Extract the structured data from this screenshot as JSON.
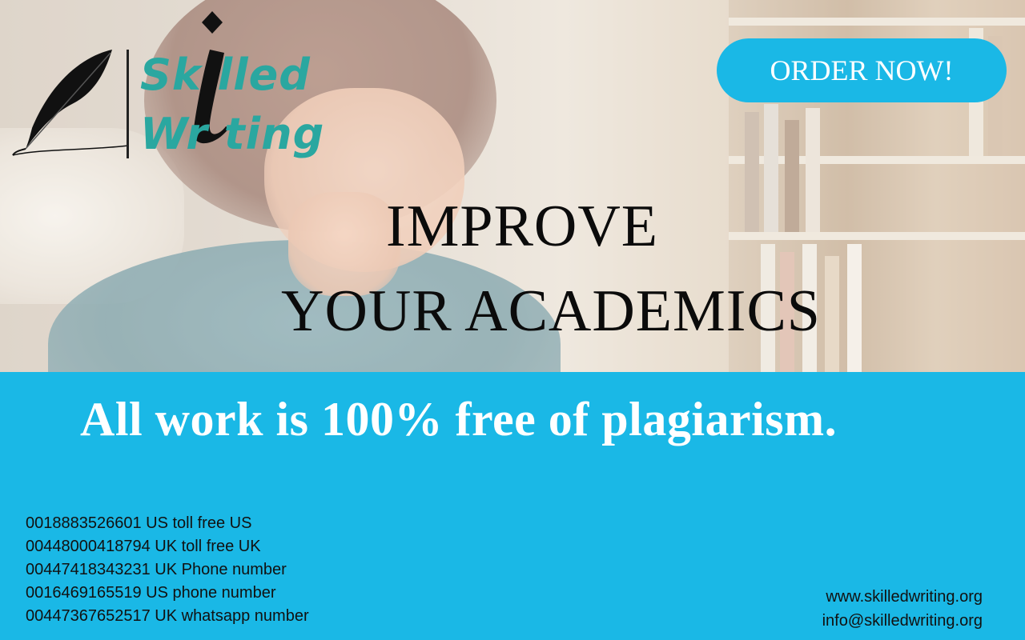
{
  "logo": {
    "line1": "Sk  lled",
    "line2": "Wr   ting"
  },
  "order_button": {
    "label": "ORDER NOW!"
  },
  "headline": {
    "line1": "IMPROVE",
    "line2": "YOUR ACADEMICS"
  },
  "tagline": "All work is 100% free of plagiarism.",
  "contacts": [
    "0018883526601 US toll free US",
    "00448000418794 UK toll free UK",
    "00447418343231 UK Phone number",
    "0016469165519 US phone number",
    "00447367652517 UK whatsapp number"
  ],
  "website": "www.skilledwriting.org",
  "email": "info@skilledwriting.org",
  "colors": {
    "accent_blue": "#1ab8e6",
    "logo_teal": "#2aa7a0",
    "headline": "#0b0b0b"
  }
}
